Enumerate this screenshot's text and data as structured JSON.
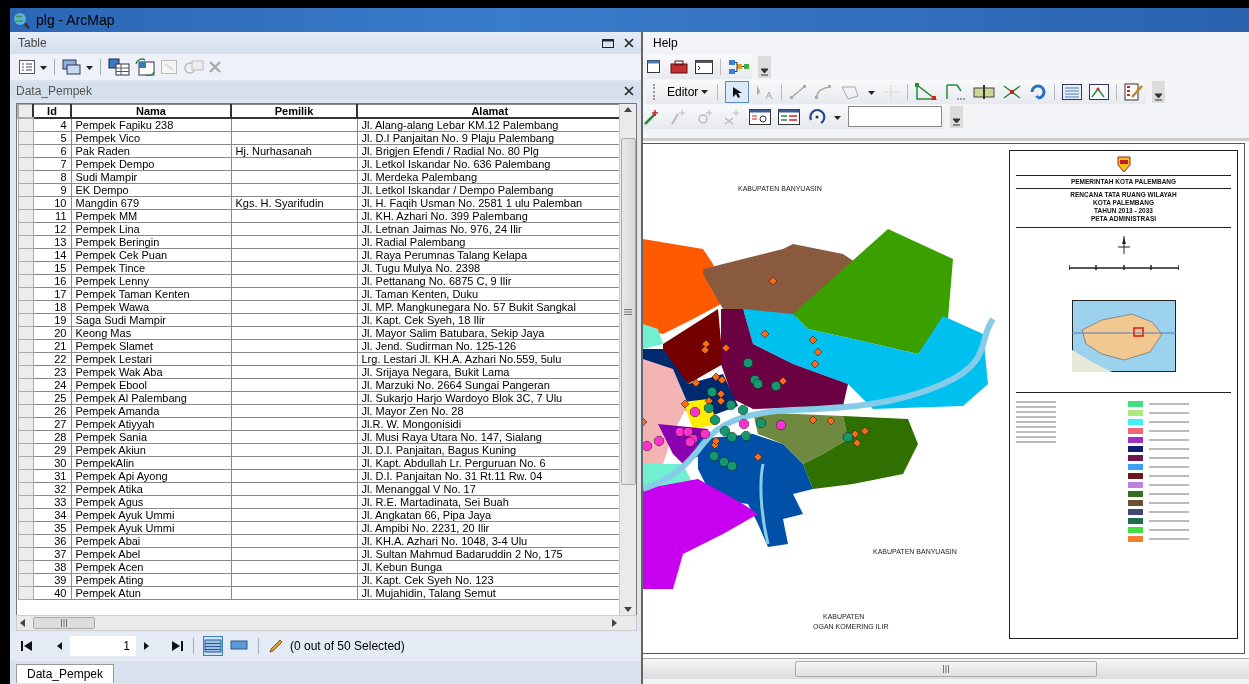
{
  "window": {
    "title": "plg - ArcMap"
  },
  "menu": [
    {
      "label": "Help"
    }
  ],
  "editor_toolbar": {
    "label": "Editor",
    "edit_tool": {
      "selected": true
    }
  },
  "table_window": {
    "title": "Table",
    "table_name": "Data_Pempek",
    "columns": [
      "Id",
      "Nama",
      "Pemilik",
      "Alamat"
    ],
    "rows": [
      {
        "id": "4",
        "nama": "Pempek Fapiku 238",
        "alamat": "Jl. Alang-alang Lebar KM.12 Palembang"
      },
      {
        "id": "5",
        "nama": "Pempek Vico",
        "alamat": "Jl. D.I Panjaitan No. 9 Plaju Palembang"
      },
      {
        "id": "6",
        "nama": "Pak Raden",
        "pemilik": "Hj. Nurhasanah",
        "alamat": "Jl. Brigjen Efendi / Radial No. 80 Plg"
      },
      {
        "id": "7",
        "nama": "Pempek Dempo",
        "alamat": "Jl. Letkol Iskandar No. 636 Palembang"
      },
      {
        "id": "8",
        "nama": "Sudi Mampir",
        "alamat": "Jl. Merdeka Palembang"
      },
      {
        "id": "9",
        "nama": "EK Dempo",
        "alamat": "Jl. Letkol Iskandar / Dempo Palembang"
      },
      {
        "id": "10",
        "nama": "Mangdin 679",
        "pemilik": "Kgs. H. Syarifudin",
        "alamat": "Jl. H. Faqih Usman No. 2581 1 ulu Palemban"
      },
      {
        "id": "11",
        "nama": "Pempek MM",
        "alamat": "Jl. KH. Azhari No. 399 Palembang"
      },
      {
        "id": "12",
        "nama": "Pempek Lina",
        "alamat": "Jl. Letnan Jaimas No. 976, 24 Ilir"
      },
      {
        "id": "13",
        "nama": "Pempek Beringin",
        "alamat": "Jl. Radial Palembang"
      },
      {
        "id": "14",
        "nama": "Pempek Cek Puan",
        "alamat": "Jl. Raya Perumnas Talang Kelapa"
      },
      {
        "id": "15",
        "nama": "Pempek Tince",
        "alamat": "Jl. Tugu Mulya No. 2398"
      },
      {
        "id": "16",
        "nama": "Pempek Lenny",
        "alamat": "Jl. Pettanang No. 6875 C, 9 Ilir"
      },
      {
        "id": "17",
        "nama": "Pempek Taman Kenten",
        "alamat": "Jl. Taman Kenten, Duku"
      },
      {
        "id": "18",
        "nama": "Pempek Wawa",
        "alamat": "Jl. MP. Mangkunegara No. 57 Bukit Sangkal"
      },
      {
        "id": "19",
        "nama": "Saga Sudi Mampir",
        "alamat": "Jl. Kapt. Cek Syeh, 18 Ilir"
      },
      {
        "id": "20",
        "nama": "Keong Mas",
        "alamat": "Jl. Mayor Salim Batubara, Sekip Jaya"
      },
      {
        "id": "21",
        "nama": "Pempek Slamet",
        "alamat": "Jl. Jend. Sudirman No. 125-126"
      },
      {
        "id": "22",
        "nama": "Pempek Lestari",
        "alamat": "Lrg. Lestari Jl. KH.A. Azhari No.559, 5ulu"
      },
      {
        "id": "23",
        "nama": "Pempek Wak Aba",
        "alamat": "Jl. Srijaya Negara, Bukit Lama"
      },
      {
        "id": "24",
        "nama": "Pempek Ebool",
        "alamat": "Jl. Marzuki No. 2664 Sungai Pangeran"
      },
      {
        "id": "25",
        "nama": "Pempek Al Palembang",
        "alamat": "Jl. Sukarjo Harjo Wardoyo Blok 3C, 7 Ulu"
      },
      {
        "id": "26",
        "nama": "Pempek Amanda",
        "alamat": "Jl. Mayor Zen No. 28"
      },
      {
        "id": "27",
        "nama": "Pempek Atiyyah",
        "alamat": "Jl.R. W. Mongonisidi"
      },
      {
        "id": "28",
        "nama": "Pempek Sania",
        "alamat": "Jl. Musi Raya Utara No. 147, Sialang"
      },
      {
        "id": "29",
        "nama": "Pempek Akiun",
        "alamat": "Jl. D.I. Panjaitan, Bagus Kuning"
      },
      {
        "id": "30",
        "nama": "PempekAlin",
        "alamat": "Jl. Kapt. Abdullah Lr. Perguruan No. 6"
      },
      {
        "id": "31",
        "nama": "Pempek Api Ayong",
        "alamat": "Jl. D.I. Panjaitan No. 31 Rt.11 Rw. 04"
      },
      {
        "id": "32",
        "nama": "Pempek Atika",
        "alamat": "Jl. Menanggal V No. 17"
      },
      {
        "id": "33",
        "nama": "Pempek Agus",
        "alamat": "Jl. R.E. Martadinata, Sei Buah"
      },
      {
        "id": "34",
        "nama": "Pempek Ayuk Ummi",
        "alamat": "Jl. Angkatan 66, Pipa Jaya"
      },
      {
        "id": "35",
        "nama": "Pempek Ayuk Ummi",
        "alamat": "Jl. Ampibi No. 2231, 20 Ilir"
      },
      {
        "id": "36",
        "nama": "Pempek Abai",
        "alamat": "Jl. KH.A. Azhari No. 1048, 3-4 Ulu"
      },
      {
        "id": "37",
        "nama": "Pempek Abel",
        "alamat": "Jl. Sultan Mahmud Badaruddin 2 No, 175"
      },
      {
        "id": "38",
        "nama": "Pempek Acen",
        "alamat": "Jl. Kebun Bunga"
      },
      {
        "id": "39",
        "nama": "Pempek Ating",
        "alamat": "Jl. Kapt. Cek Syeh No. 123"
      },
      {
        "id": "40",
        "nama": "Pempek Atun",
        "alamat": "Jl. Mujahidin, Talang Semut"
      }
    ],
    "record": "1",
    "selection_status": "(0 out of 50 Selected)",
    "view_buttons": [
      {
        "selected": true
      },
      {
        "selected": false
      }
    ],
    "tabs": [
      {
        "label": "Data_Pempek",
        "selected": true
      }
    ]
  },
  "map": {
    "labels": [
      "KABUPATEN BANYUASIN",
      "KABUPATEN BANYUASIN",
      "KABUPATEN",
      "OGAN KOMERING ILIR"
    ],
    "legend_title": [
      "PEMERINTAH KOTA PALEMBANG",
      "RENCANA TATA RUANG WILAYAH",
      "KOTA PALEMBANG",
      "TAHUN 2013 - 2033",
      "PETA ADMINISTRASI"
    ],
    "legend_swatches": [
      {
        "color": "#40e080"
      },
      {
        "color": "#b0e878"
      },
      {
        "color": "#40f0f0"
      },
      {
        "color": "#f06878"
      },
      {
        "color": "#a030c0"
      },
      {
        "color": "#1a1a70"
      },
      {
        "color": "#701850"
      },
      {
        "color": "#40a0f0"
      },
      {
        "color": "#6a1a1a"
      },
      {
        "color": "#c080e0"
      },
      {
        "color": "#307020"
      },
      {
        "color": "#6a5030"
      },
      {
        "color": "#404870"
      },
      {
        "color": "#206a50"
      },
      {
        "color": "#40e040"
      },
      {
        "color": "#f08030"
      }
    ]
  }
}
